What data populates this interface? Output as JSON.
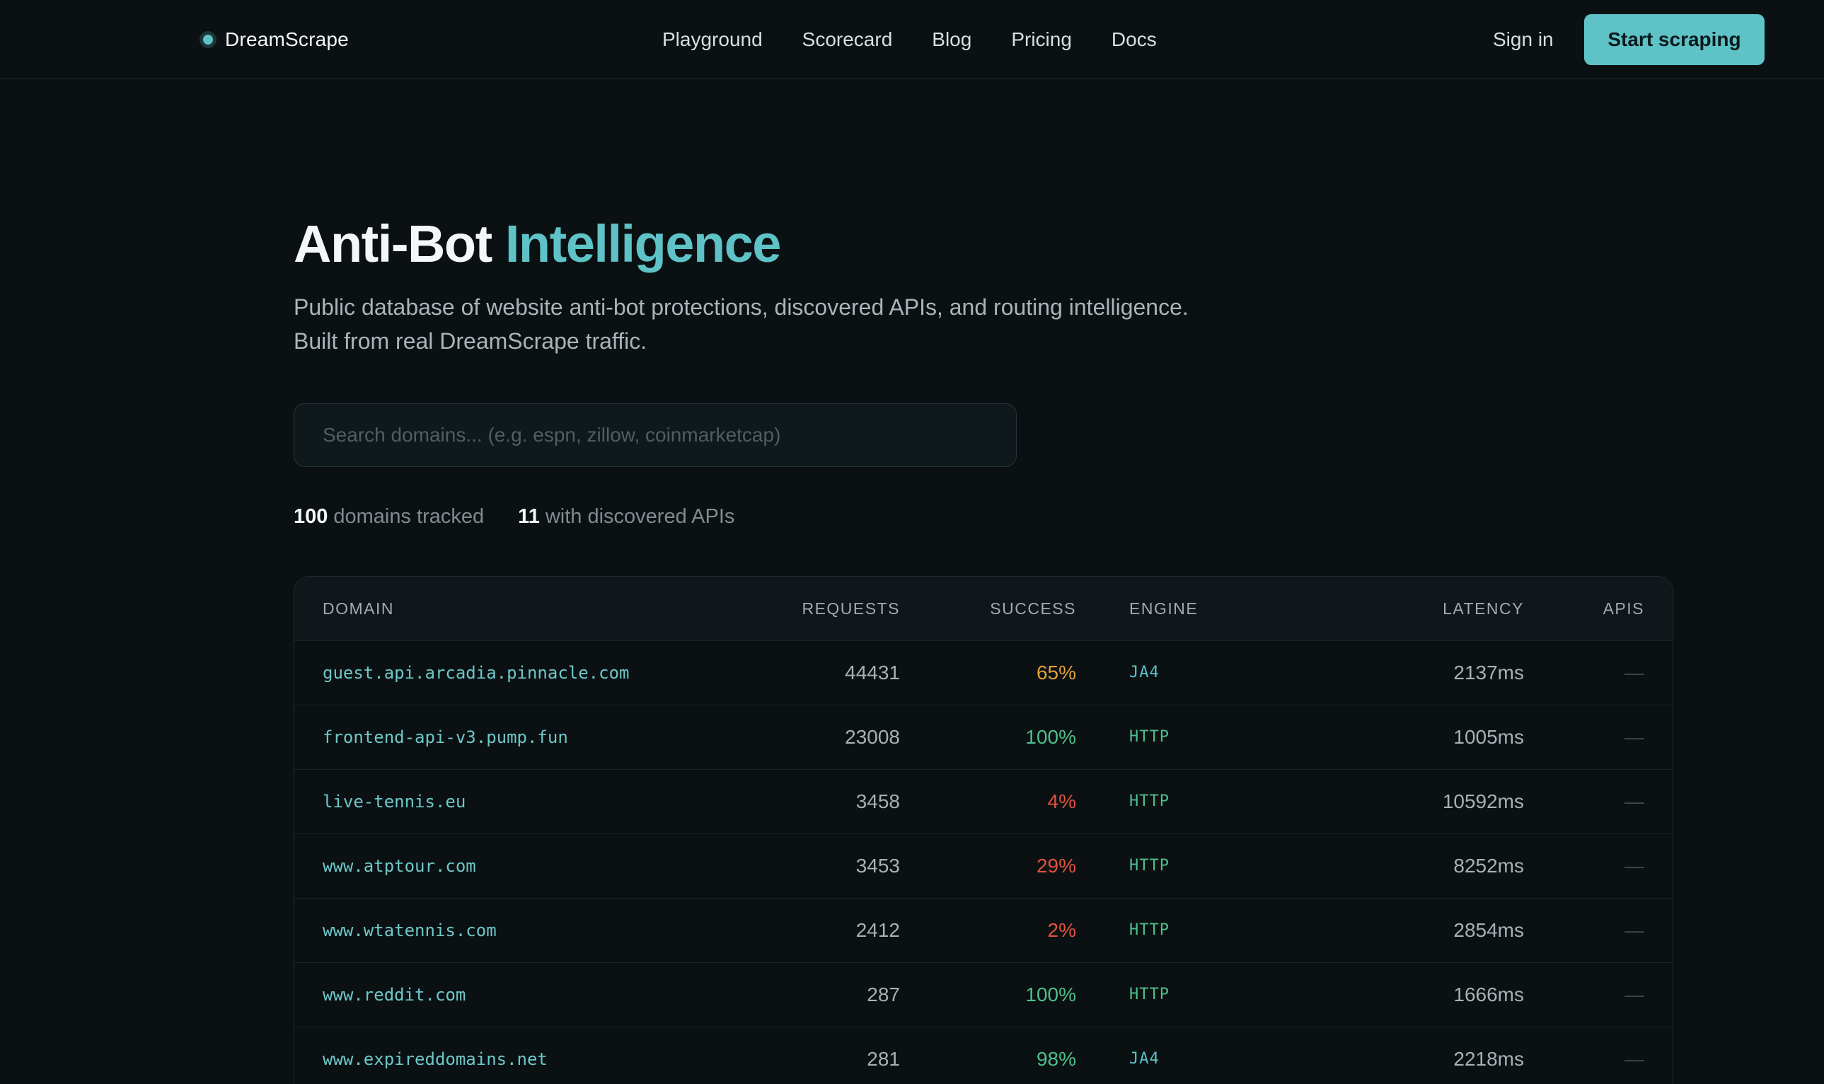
{
  "header": {
    "logo": "DreamScrape",
    "nav": [
      "Playground",
      "Scorecard",
      "Blog",
      "Pricing",
      "Docs"
    ],
    "signin": "Sign in",
    "cta": "Start scraping"
  },
  "hero": {
    "title_main": "Anti-Bot",
    "title_accent": "Intelligence",
    "subtitle_line1": "Public database of website anti-bot protections, discovered APIs, and routing intelligence.",
    "subtitle_line2": "Built from real DreamScrape traffic."
  },
  "search": {
    "placeholder": "Search domains... (e.g. espn, zillow, coinmarketcap)",
    "value": ""
  },
  "stats": {
    "domains_count": "100",
    "domains_label": "domains tracked",
    "apis_count": "11",
    "apis_label": "with discovered APIs"
  },
  "table": {
    "columns": [
      "DOMAIN",
      "REQUESTS",
      "SUCCESS",
      "ENGINE",
      "LATENCY",
      "APIS"
    ],
    "rows": [
      {
        "domain": "guest.api.arcadia.pinnacle.com",
        "requests": "44431",
        "success": "65%",
        "engine": "JA4",
        "latency": "2137ms",
        "apis": "—"
      },
      {
        "domain": "frontend-api-v3.pump.fun",
        "requests": "23008",
        "success": "100%",
        "engine": "HTTP",
        "latency": "1005ms",
        "apis": "—"
      },
      {
        "domain": "live-tennis.eu",
        "requests": "3458",
        "success": "4%",
        "engine": "HTTP",
        "latency": "10592ms",
        "apis": "—"
      },
      {
        "domain": "www.atptour.com",
        "requests": "3453",
        "success": "29%",
        "engine": "HTTP",
        "latency": "8252ms",
        "apis": "—"
      },
      {
        "domain": "www.wtatennis.com",
        "requests": "2412",
        "success": "2%",
        "engine": "HTTP",
        "latency": "2854ms",
        "apis": "—"
      },
      {
        "domain": "www.reddit.com",
        "requests": "287",
        "success": "100%",
        "engine": "HTTP",
        "latency": "1666ms",
        "apis": "—"
      },
      {
        "domain": "www.expireddomains.net",
        "requests": "281",
        "success": "98%",
        "engine": "JA4",
        "latency": "2218ms",
        "apis": "—"
      }
    ]
  },
  "colors": {
    "accent": "#5ec2c6",
    "success_high": "#4fbf8b",
    "success_mid": "#e0a13d",
    "success_low": "#e0523f",
    "engine_ja4": "#5ec2c6",
    "engine_http": "#4fbf8b"
  }
}
